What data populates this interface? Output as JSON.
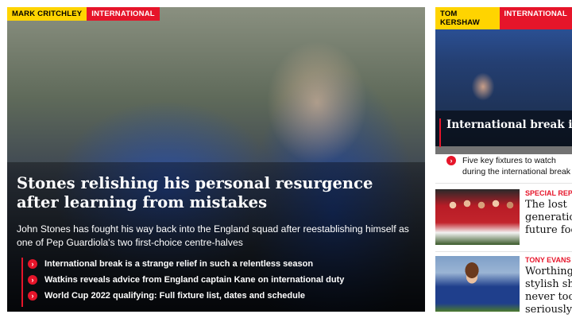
{
  "hero": {
    "author": "MARK CRITCHLEY",
    "category": "INTERNATIONAL",
    "headline": "Stones relishing his personal resurgence after learning from mistakes",
    "summary": "John Stones has fought his way back into the England squad after reestablishing himself as one of Pep Guardiola's two first-choice centre-halves",
    "related": [
      "International break is a strange relief in such a relentless season",
      "Watkins reveals advice from England captain Kane on international duty",
      "World Cup 2022 qualifying: Full fixture list, dates and schedule"
    ]
  },
  "featured": {
    "author": "TOM KERSHAW",
    "category": "INTERNATIONAL",
    "headline": "International break is a strange relief in such a relentless season",
    "link": "Five key fixtures to watch during the international break"
  },
  "cards": [
    {
      "label": "SPECIAL REPORT",
      "title": "The lost generation and future football"
    },
    {
      "label": "TONY EVANS",
      "title": "Worthington's stylish show never took it seriously"
    }
  ],
  "colors": {
    "accent_red": "#e6152a",
    "tag_yellow": "#ffd400"
  },
  "icons": {
    "link_bullet": "chevron-right-icon"
  }
}
